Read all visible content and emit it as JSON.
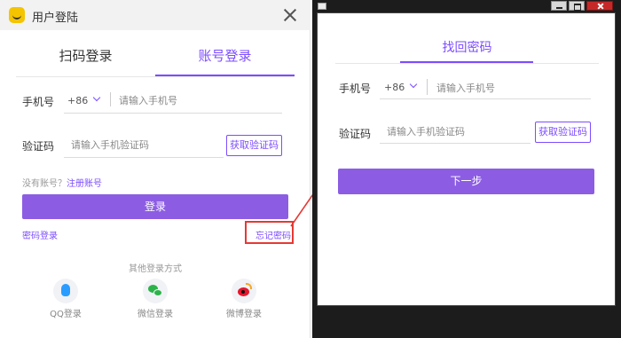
{
  "login": {
    "title": "用户登陆",
    "tabs": {
      "qr": "扫码登录",
      "account": "账号登录"
    },
    "phone_label": "手机号",
    "country_code": "+86",
    "phone_placeholder": "请输入手机号",
    "code_label": "验证码",
    "code_placeholder": "请输入手机验证码",
    "get_code": "获取验证码",
    "no_account": "没有账号？",
    "register": "注册账号",
    "login_button": "登录",
    "password_login": "密码登录",
    "forgot_password": "忘记密码",
    "other_methods": "其他登录方式",
    "social": {
      "qq": "QQ登录",
      "wechat": "微信登录",
      "weibo": "微博登录"
    }
  },
  "recover": {
    "title": "找回密码",
    "phone_label": "手机号",
    "country_code": "+86",
    "phone_placeholder": "请输入手机号",
    "code_label": "验证码",
    "code_placeholder": "请输入手机验证码",
    "get_code": "获取验证码",
    "next_button": "下一步"
  },
  "colors": {
    "accent": "#7c4dff",
    "button": "#8c5de3",
    "highlight": "#e53935"
  }
}
